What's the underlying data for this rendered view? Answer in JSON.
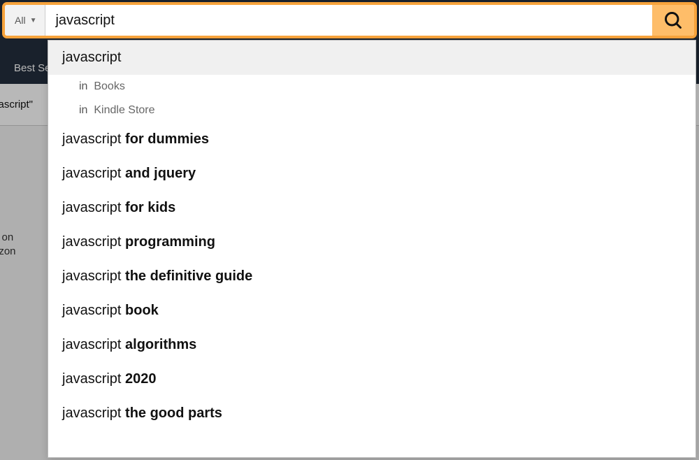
{
  "search": {
    "department_label": "All",
    "query": "javascript",
    "placeholder": ""
  },
  "secondary_nav": {
    "best_sellers": "Best Sellers"
  },
  "results_header": {
    "text": "vascript\""
  },
  "left_text": {
    "line1": "g on",
    "line2": "azon"
  },
  "suggestions": {
    "top": "javascript",
    "in_prefix": "in",
    "departments": [
      "Books",
      "Kindle Store"
    ],
    "items": [
      {
        "plain": "javascript ",
        "bold": "for dummies"
      },
      {
        "plain": "javascript ",
        "bold": "and jquery"
      },
      {
        "plain": "javascript ",
        "bold": "for kids"
      },
      {
        "plain": "javascript ",
        "bold": "programming"
      },
      {
        "plain": "javascript ",
        "bold": "the definitive guide"
      },
      {
        "plain": "javascript ",
        "bold": "book"
      },
      {
        "plain": "javascript ",
        "bold": "algorithms"
      },
      {
        "plain": "javascript ",
        "bold": "2020"
      },
      {
        "plain": "javascript ",
        "bold": "the good parts"
      }
    ]
  }
}
